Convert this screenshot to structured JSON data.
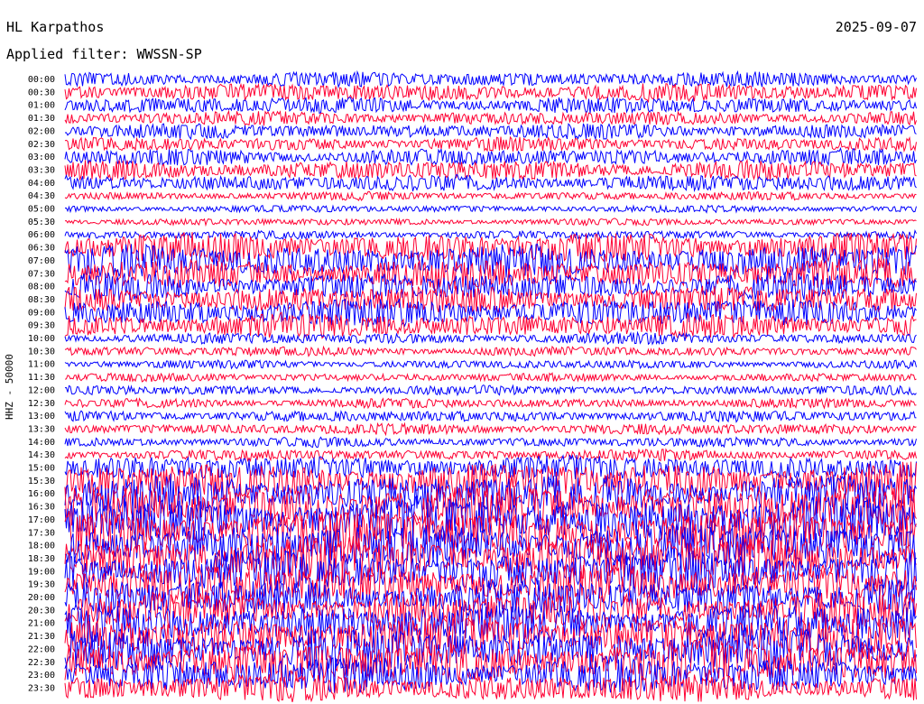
{
  "header": {
    "station": "HL Karpathos",
    "date": "2025-09-07",
    "filter": "Applied filter: WWSSN-SP"
  },
  "chart_data": {
    "type": "line",
    "ylabel": "HHZ - 50000",
    "colors": [
      "#0000ff",
      "#ff0033"
    ],
    "rows": [
      {
        "time": "00:00",
        "activity": 0.55
      },
      {
        "time": "00:30",
        "activity": 0.65
      },
      {
        "time": "01:00",
        "activity": 0.6
      },
      {
        "time": "01:30",
        "activity": 0.5
      },
      {
        "time": "02:00",
        "activity": 0.55
      },
      {
        "time": "02:30",
        "activity": 0.5
      },
      {
        "time": "03:00",
        "activity": 0.6
      },
      {
        "time": "03:30",
        "activity": 0.7
      },
      {
        "time": "04:00",
        "activity": 0.6
      },
      {
        "time": "04:30",
        "activity": 0.3
      },
      {
        "time": "05:00",
        "activity": 0.25
      },
      {
        "time": "05:30",
        "activity": 0.25
      },
      {
        "time": "06:00",
        "activity": 0.3
      },
      {
        "time": "06:30",
        "activity": 1.1
      },
      {
        "time": "07:00",
        "activity": 1.2
      },
      {
        "time": "07:30",
        "activity": 1.1
      },
      {
        "time": "08:00",
        "activity": 1.0
      },
      {
        "time": "08:30",
        "activity": 1.0
      },
      {
        "time": "09:00",
        "activity": 1.0
      },
      {
        "time": "09:30",
        "activity": 0.9
      },
      {
        "time": "10:00",
        "activity": 0.4
      },
      {
        "time": "10:30",
        "activity": 0.35
      },
      {
        "time": "11:00",
        "activity": 0.3
      },
      {
        "time": "11:30",
        "activity": 0.3
      },
      {
        "time": "12:00",
        "activity": 0.35
      },
      {
        "time": "12:30",
        "activity": 0.35
      },
      {
        "time": "13:00",
        "activity": 0.4
      },
      {
        "time": "13:30",
        "activity": 0.4
      },
      {
        "time": "14:00",
        "activity": 0.35
      },
      {
        "time": "14:30",
        "activity": 0.4
      },
      {
        "time": "15:00",
        "activity": 0.9
      },
      {
        "time": "15:30",
        "activity": 1.3
      },
      {
        "time": "16:00",
        "activity": 1.4
      },
      {
        "time": "16:30",
        "activity": 1.5
      },
      {
        "time": "17:00",
        "activity": 1.6
      },
      {
        "time": "17:30",
        "activity": 1.6
      },
      {
        "time": "18:00",
        "activity": 1.6
      },
      {
        "time": "18:30",
        "activity": 1.6
      },
      {
        "time": "19:00",
        "activity": 1.5
      },
      {
        "time": "19:30",
        "activity": 1.4
      },
      {
        "time": "20:00",
        "activity": 1.3
      },
      {
        "time": "20:30",
        "activity": 1.3
      },
      {
        "time": "21:00",
        "activity": 1.4
      },
      {
        "time": "21:30",
        "activity": 1.4
      },
      {
        "time": "22:00",
        "activity": 1.5
      },
      {
        "time": "22:30",
        "activity": 1.5
      },
      {
        "time": "23:00",
        "activity": 1.3
      },
      {
        "time": "23:30",
        "activity": 1.0
      }
    ]
  }
}
